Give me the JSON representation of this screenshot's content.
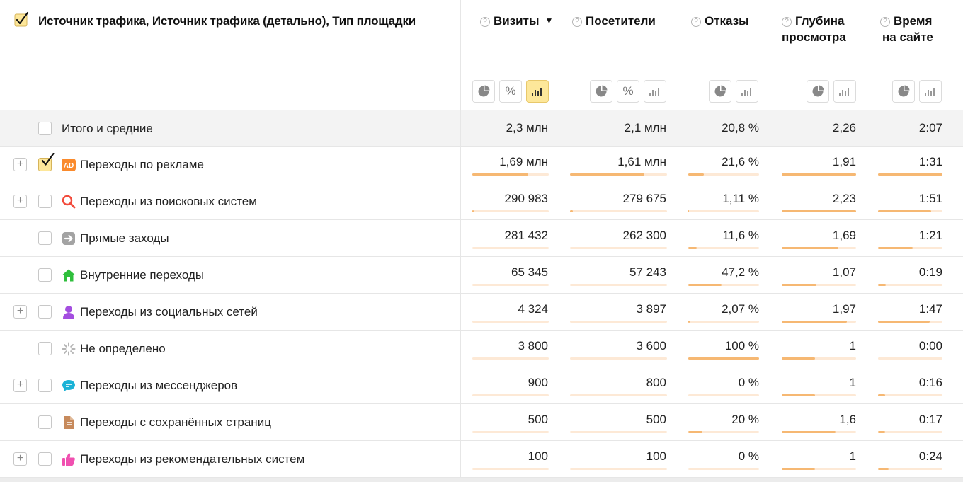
{
  "header": {
    "dimension_title": "Источник трафика, Источник трафика (детально), Тип площадки",
    "help_glyph": "?",
    "sort_glyph": "▼",
    "metrics": [
      {
        "id": "visits",
        "line1": "Визиты",
        "line2": "",
        "sorted": true
      },
      {
        "id": "visitors",
        "line1": "Посетители",
        "line2": ""
      },
      {
        "id": "bounce",
        "line1": "Отказы",
        "line2": ""
      },
      {
        "id": "depth",
        "line1": "Глубина",
        "line2": "просмотра"
      },
      {
        "id": "time",
        "line1": "Время",
        "line2": "на сайте"
      }
    ],
    "view_buttons": {
      "percent_glyph": "%",
      "active": "bar-chart (Визиты)"
    }
  },
  "totals": {
    "label": "Итого и средние",
    "values": [
      "2,3 млн",
      "2,1 млн",
      "20,8 %",
      "2,26",
      "2:07"
    ]
  },
  "rows": [
    {
      "label": "Переходы по рекламе",
      "icon": "ad-icon",
      "expandable": true,
      "checked": true,
      "values": [
        "1,69 млн",
        "1,61 млн",
        "21,6 %",
        "1,91",
        "1:31"
      ],
      "shares": [
        0.73,
        0.77,
        0.216,
        1.0,
        1.0
      ]
    },
    {
      "label": "Переходы из поисковых систем",
      "icon": "search-icon",
      "expandable": true,
      "checked": false,
      "values": [
        "290 983",
        "279 675",
        "1,11 %",
        "2,23",
        "1:51"
      ],
      "shares": [
        0.02,
        0.03,
        0.011,
        1.0,
        0.82
      ]
    },
    {
      "label": "Прямые заходы",
      "icon": "direct-arrow-icon",
      "expandable": false,
      "checked": false,
      "values": [
        "281 432",
        "262 300",
        "11,6 %",
        "1,69",
        "1:21"
      ],
      "shares": [
        0.0,
        0.0,
        0.116,
        0.76,
        0.54
      ]
    },
    {
      "label": "Внутренние переходы",
      "icon": "home-icon",
      "expandable": false,
      "checked": false,
      "values": [
        "65 345",
        "57 243",
        "47,2 %",
        "1,07",
        "0:19"
      ],
      "shares": [
        0.0,
        0.0,
        0.472,
        0.47,
        0.12
      ]
    },
    {
      "label": "Переходы из социальных сетей",
      "icon": "social-user-icon",
      "expandable": true,
      "checked": false,
      "values": [
        "4 324",
        "3 897",
        "2,07 %",
        "1,97",
        "1:47"
      ],
      "shares": [
        0.0,
        0.0,
        0.021,
        0.88,
        0.8
      ]
    },
    {
      "label": "Не определено",
      "icon": "spinner-icon",
      "expandable": false,
      "checked": false,
      "values": [
        "3 800",
        "3 600",
        "100 %",
        "1",
        "0:00"
      ],
      "shares": [
        0.0,
        0.0,
        1.0,
        0.45,
        0.0
      ]
    },
    {
      "label": "Переходы из мессенджеров",
      "icon": "messenger-icon",
      "expandable": true,
      "checked": false,
      "values": [
        "900",
        "800",
        "0 %",
        "1",
        "0:16"
      ],
      "shares": [
        0.0,
        0.0,
        0.0,
        0.45,
        0.11
      ]
    },
    {
      "label": "Переходы с сохранённых страниц",
      "icon": "saved-page-icon",
      "expandable": false,
      "checked": false,
      "values": [
        "500",
        "500",
        "20 %",
        "1,6",
        "0:17"
      ],
      "shares": [
        0.0,
        0.0,
        0.2,
        0.72,
        0.11
      ]
    },
    {
      "label": "Переходы из рекомендательных систем",
      "icon": "thumbs-up-icon",
      "expandable": true,
      "checked": false,
      "values": [
        "100",
        "100",
        "0 %",
        "1",
        "0:24"
      ],
      "shares": [
        0.0,
        0.0,
        0.0,
        0.45,
        0.16
      ]
    }
  ],
  "colors": {
    "accent_bar": "#f6b873",
    "bar_track": "#fde9d6",
    "active_button": "#fde79a",
    "total_row_bg": "#f3f3f3"
  }
}
